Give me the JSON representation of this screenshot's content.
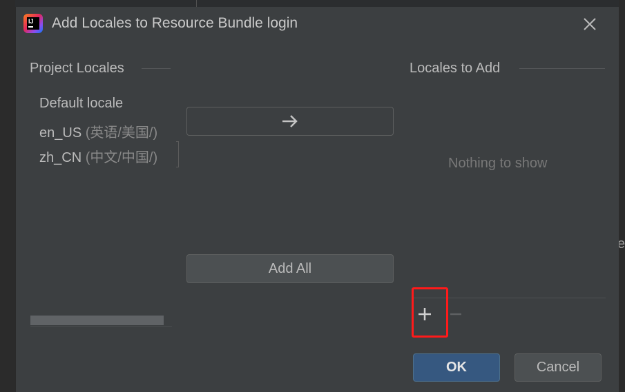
{
  "dialog": {
    "title": "Add Locales to Resource Bundle login",
    "app_icon": "intellij-idea-icon",
    "close_icon": "close-icon"
  },
  "project_locales": {
    "header": "Project Locales",
    "items": [
      {
        "code": "Default locale",
        "native": ""
      },
      {
        "code": "en_US",
        "native": "(英语/美国/)"
      },
      {
        "code": "zh_CN",
        "native": "(中文/中国/)"
      }
    ]
  },
  "transfer": {
    "move_icon": "arrow-right-icon",
    "add_all_label": "Add All"
  },
  "locales_to_add": {
    "header": "Locales to Add",
    "empty_text": "Nothing to show",
    "add_icon": "plus-icon",
    "remove_icon": "minus-icon"
  },
  "buttons": {
    "ok_label": "OK",
    "cancel_label": "Cancel"
  },
  "colors": {
    "dialog_bg": "#3c3f41",
    "primary_button": "#365880",
    "highlight": "#ff1a1a"
  },
  "background": {
    "edge_letter": "e"
  }
}
